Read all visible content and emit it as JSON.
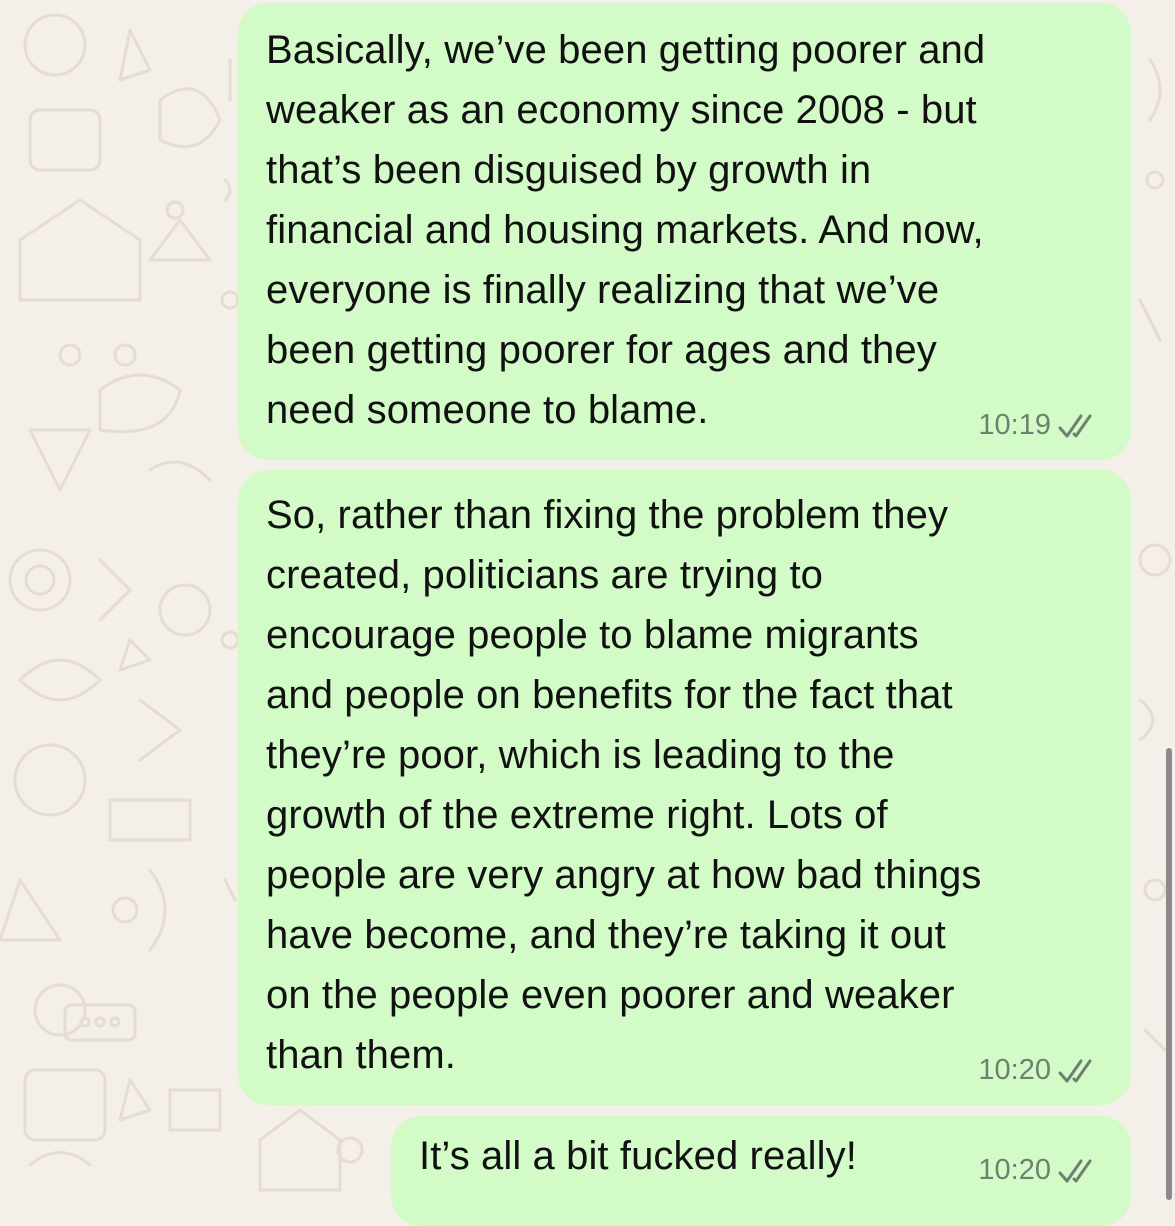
{
  "theme": {
    "background": "#f4efe8",
    "doodle_color": "#e6dccf",
    "outgoing_bubble": "#d3fbc7",
    "text_color": "#111111",
    "meta_color": "#6f7f70"
  },
  "messages": [
    {
      "text": "Basically, we’ve been getting poorer and\nweaker as an economy since 2008 - but\nthat’s been disguised by growth in\nfinancial and housing markets. And now,\neveryone is finally realizing that we’ve\nbeen getting poorer for ages and they\nneed someone to blame.",
      "time": "10:19",
      "status_icon": "double-check-icon"
    },
    {
      "text": "So, rather than fixing the problem they\ncreated, politicians are trying to\nencourage people to blame migrants\nand people on benefits for the fact that\nthey’re poor, which is leading to the\ngrowth of the extreme right. Lots of\npeople are very angry at how bad things\nhave become, and they’re taking it out\non the people even poorer and weaker\nthan them.",
      "time": "10:20",
      "status_icon": "double-check-icon"
    },
    {
      "text": "It’s all a bit fucked really!",
      "time": "10:20",
      "status_icon": "double-check-icon"
    }
  ]
}
